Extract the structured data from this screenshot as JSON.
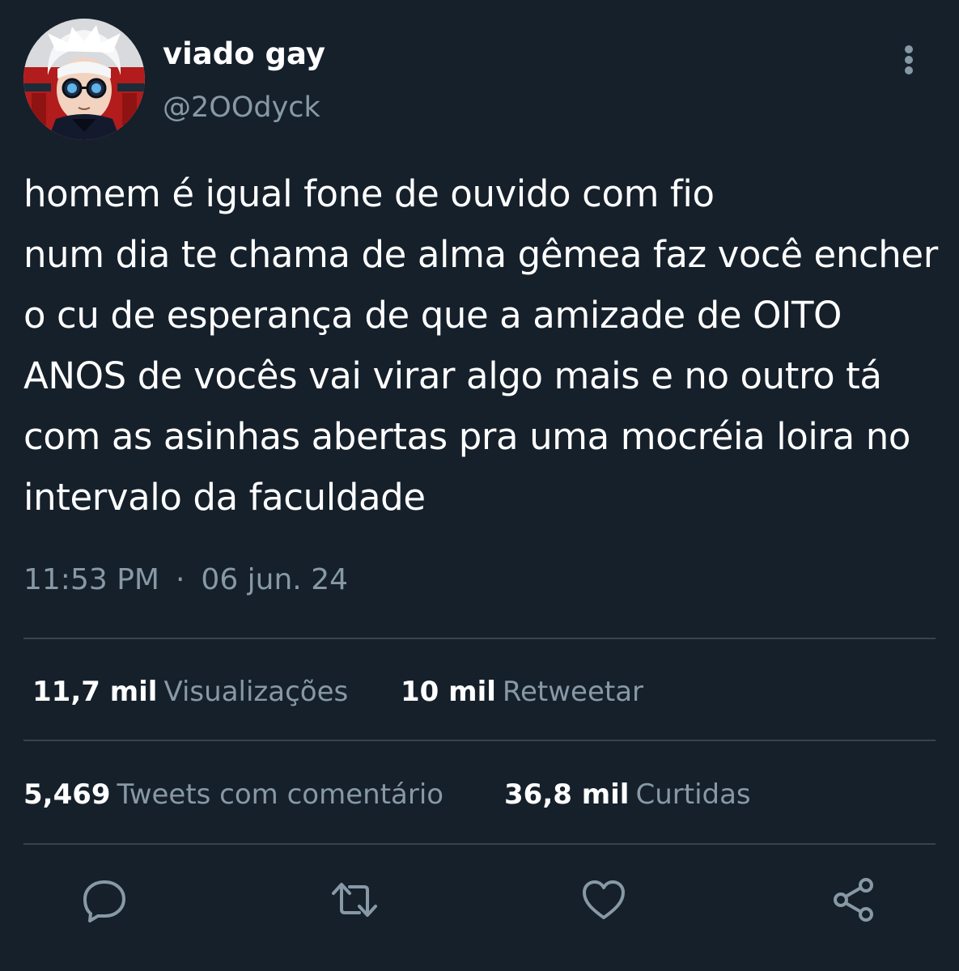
{
  "author": {
    "display_name": "viado gay",
    "handle": "@2OOdyck"
  },
  "tweet": {
    "lines": [
      "homem é igual fone de ouvido com fio",
      "num dia te chama de alma gêmea faz você encher",
      "o cu de esperança de que a amizade de OITO",
      "ANOS de vocês vai virar algo mais e no outro tá",
      "com as asinhas abertas pra uma mocréia loira no",
      "intervalo da faculdade"
    ],
    "time": "11:53 PM",
    "separator": "·",
    "date": "06 jun. 24"
  },
  "stats": {
    "views": {
      "value": "11,7 mil",
      "label": "Visualizações"
    },
    "retweets": {
      "value": "10 mil",
      "label": "Retweetar"
    },
    "quotes": {
      "value": "5,469",
      "label": "Tweets com comentário"
    },
    "likes": {
      "value": "36,8 mil",
      "label": "Curtidas"
    }
  },
  "actions": [
    "reply-icon",
    "retweet-icon",
    "like-icon",
    "share-icon"
  ],
  "colors": {
    "background": "#15202b",
    "text_primary": "#ffffff",
    "text_secondary": "#8899a6",
    "divider": "#38444d"
  }
}
